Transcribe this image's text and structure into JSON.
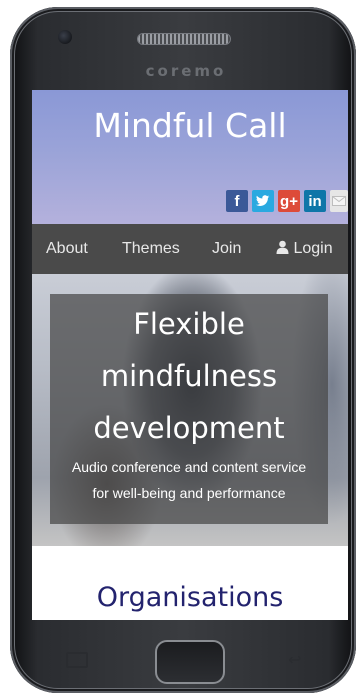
{
  "device": {
    "brand": "coremo"
  },
  "site": {
    "title": "Mindful Call"
  },
  "social": [
    {
      "name": "facebook-icon",
      "glyph": "f"
    },
    {
      "name": "twitter-icon",
      "glyph": "t"
    },
    {
      "name": "google-plus-icon",
      "glyph": "g+"
    },
    {
      "name": "linkedin-icon",
      "glyph": "in"
    },
    {
      "name": "email-icon",
      "glyph": ""
    }
  ],
  "nav": {
    "about": "About",
    "themes": "Themes",
    "join": "Join",
    "login": "Login"
  },
  "hero": {
    "line1": "Flexible",
    "line2": "mindfulness",
    "line3": "development",
    "sub1": "Audio conference and content service",
    "sub2": "for well-being and performance"
  },
  "section": {
    "title": "Organisations"
  },
  "colors": {
    "header_top": "#8a98d6",
    "nav_bg": "#4a4a4a",
    "section_title": "#23236e"
  }
}
